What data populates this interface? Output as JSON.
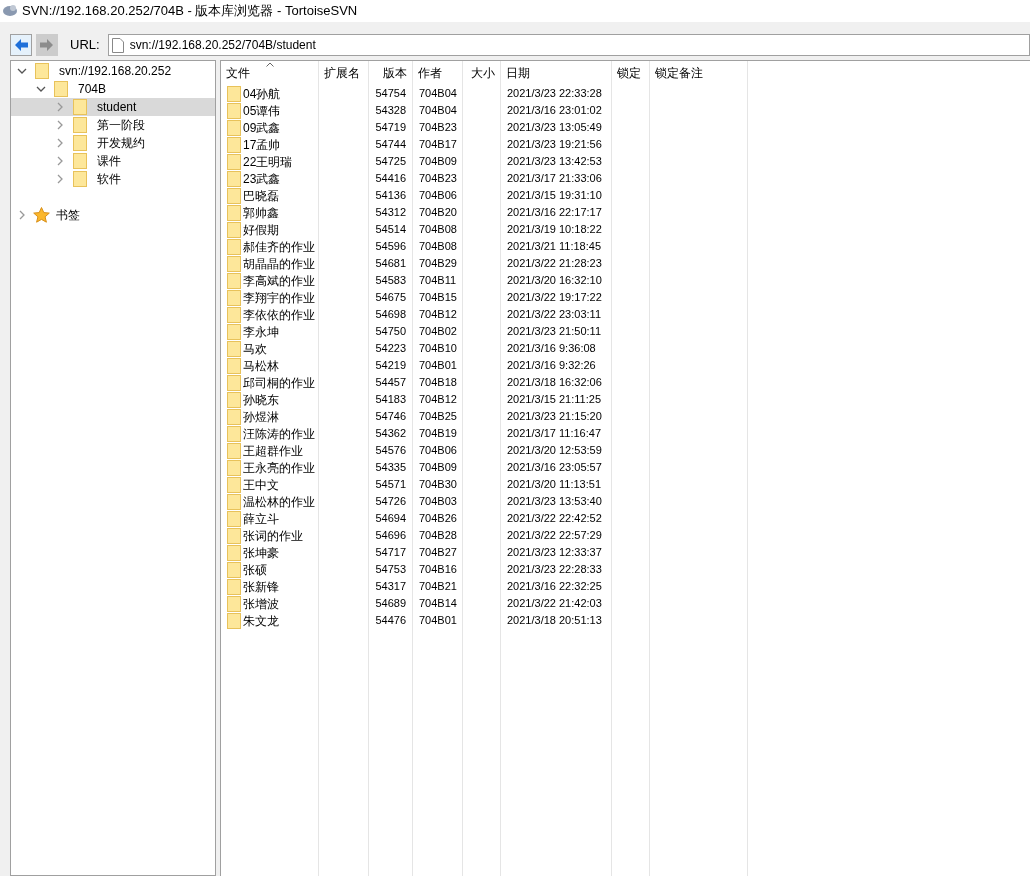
{
  "window": {
    "title": "SVN://192.168.20.252/704B - 版本库浏览器 - TortoiseSVN"
  },
  "toolbar": {
    "nav_buttons": [
      {
        "kind": "back",
        "disabled": false
      },
      {
        "kind": "forward",
        "disabled": true
      }
    ],
    "url_label": "URL:",
    "url": "svn://192.168.20.252/704B/student"
  },
  "tree": [
    {
      "label": "svn://192.168.20.252",
      "expanded": true,
      "selected": false,
      "children": [
        {
          "label": "704B",
          "expanded": true,
          "selected": false,
          "children": [
            {
              "label": "student",
              "expanded": false,
              "selected": true
            },
            {
              "label": "第一阶段",
              "expanded": false,
              "selected": false
            },
            {
              "label": "开发规约",
              "expanded": false,
              "selected": false
            },
            {
              "label": "课件",
              "expanded": false,
              "selected": false
            },
            {
              "label": "软件",
              "expanded": false,
              "selected": false
            }
          ]
        }
      ]
    }
  ],
  "bookmarks": {
    "label": "书签",
    "expanded": false
  },
  "table": {
    "columns": [
      {
        "label": "文件",
        "sorted": true
      },
      {
        "label": "扩展名",
        "sorted": false
      },
      {
        "label": "版本",
        "sorted": false
      },
      {
        "label": "作者",
        "sorted": false
      },
      {
        "label": "大小",
        "sorted": false
      },
      {
        "label": "日期",
        "sorted": false
      },
      {
        "label": "锁定",
        "sorted": false
      },
      {
        "label": "锁定备注",
        "sorted": false
      }
    ],
    "rows": [
      {
        "name": "04孙航",
        "revision": "54754",
        "author": "704B04",
        "date": "2021/3/23 22:33:28"
      },
      {
        "name": "05谭伟",
        "revision": "54328",
        "author": "704B04",
        "date": "2021/3/16 23:01:02"
      },
      {
        "name": "09武鑫",
        "revision": "54719",
        "author": "704B23",
        "date": "2021/3/23 13:05:49"
      },
      {
        "name": "17孟帅",
        "revision": "54744",
        "author": "704B17",
        "date": "2021/3/23 19:21:56"
      },
      {
        "name": "22王明瑞",
        "revision": "54725",
        "author": "704B09",
        "date": "2021/3/23 13:42:53"
      },
      {
        "name": "23武鑫",
        "revision": "54416",
        "author": "704B23",
        "date": "2021/3/17 21:33:06"
      },
      {
        "name": "巴晓磊",
        "revision": "54136",
        "author": "704B06",
        "date": "2021/3/15 19:31:10"
      },
      {
        "name": "郭帅鑫",
        "revision": "54312",
        "author": "704B20",
        "date": "2021/3/16 22:17:17"
      },
      {
        "name": "好假期",
        "revision": "54514",
        "author": "704B08",
        "date": "2021/3/19 10:18:22"
      },
      {
        "name": "郝佳齐的作业",
        "revision": "54596",
        "author": "704B08",
        "date": "2021/3/21 11:18:45"
      },
      {
        "name": "胡晶晶的作业",
        "revision": "54681",
        "author": "704B29",
        "date": "2021/3/22 21:28:23"
      },
      {
        "name": "李高斌的作业",
        "revision": "54583",
        "author": "704B11",
        "date": "2021/3/20 16:32:10"
      },
      {
        "name": "李翔宇的作业",
        "revision": "54675",
        "author": "704B15",
        "date": "2021/3/22 19:17:22"
      },
      {
        "name": "李依依的作业",
        "revision": "54698",
        "author": "704B12",
        "date": "2021/3/22 23:03:11"
      },
      {
        "name": "李永坤",
        "revision": "54750",
        "author": "704B02",
        "date": "2021/3/23 21:50:11"
      },
      {
        "name": "马欢",
        "revision": "54223",
        "author": "704B10",
        "date": "2021/3/16 9:36:08"
      },
      {
        "name": "马松林",
        "revision": "54219",
        "author": "704B01",
        "date": "2021/3/16 9:32:26"
      },
      {
        "name": "邱司桐的作业",
        "revision": "54457",
        "author": "704B18",
        "date": "2021/3/18 16:32:06"
      },
      {
        "name": "孙晓东",
        "revision": "54183",
        "author": "704B12",
        "date": "2021/3/15 21:11:25"
      },
      {
        "name": "孙煜淋",
        "revision": "54746",
        "author": "704B25",
        "date": "2021/3/23 21:15:20"
      },
      {
        "name": "汪陈涛的作业",
        "revision": "54362",
        "author": "704B19",
        "date": "2021/3/17 11:16:47"
      },
      {
        "name": "王超群作业",
        "revision": "54576",
        "author": "704B06",
        "date": "2021/3/20 12:53:59"
      },
      {
        "name": "王永亮的作业",
        "revision": "54335",
        "author": "704B09",
        "date": "2021/3/16 23:05:57"
      },
      {
        "name": "王中文",
        "revision": "54571",
        "author": "704B30",
        "date": "2021/3/20 11:13:51"
      },
      {
        "name": "温松林的作业",
        "revision": "54726",
        "author": "704B03",
        "date": "2021/3/23 13:53:40"
      },
      {
        "name": "薛立斗",
        "revision": "54694",
        "author": "704B26",
        "date": "2021/3/22 22:42:52"
      },
      {
        "name": "张词的作业",
        "revision": "54696",
        "author": "704B28",
        "date": "2021/3/22 22:57:29"
      },
      {
        "name": "张坤豪",
        "revision": "54717",
        "author": "704B27",
        "date": "2021/3/23 12:33:37"
      },
      {
        "name": "张硕",
        "revision": "54753",
        "author": "704B16",
        "date": "2021/3/23 22:28:33"
      },
      {
        "name": "张新锋",
        "revision": "54317",
        "author": "704B21",
        "date": "2021/3/16 22:32:25"
      },
      {
        "name": "张增波",
        "revision": "54689",
        "author": "704B14",
        "date": "2021/3/22 21:42:03"
      },
      {
        "name": "朱文龙",
        "revision": "54476",
        "author": "704B01",
        "date": "2021/3/18 20:51:13"
      }
    ]
  }
}
